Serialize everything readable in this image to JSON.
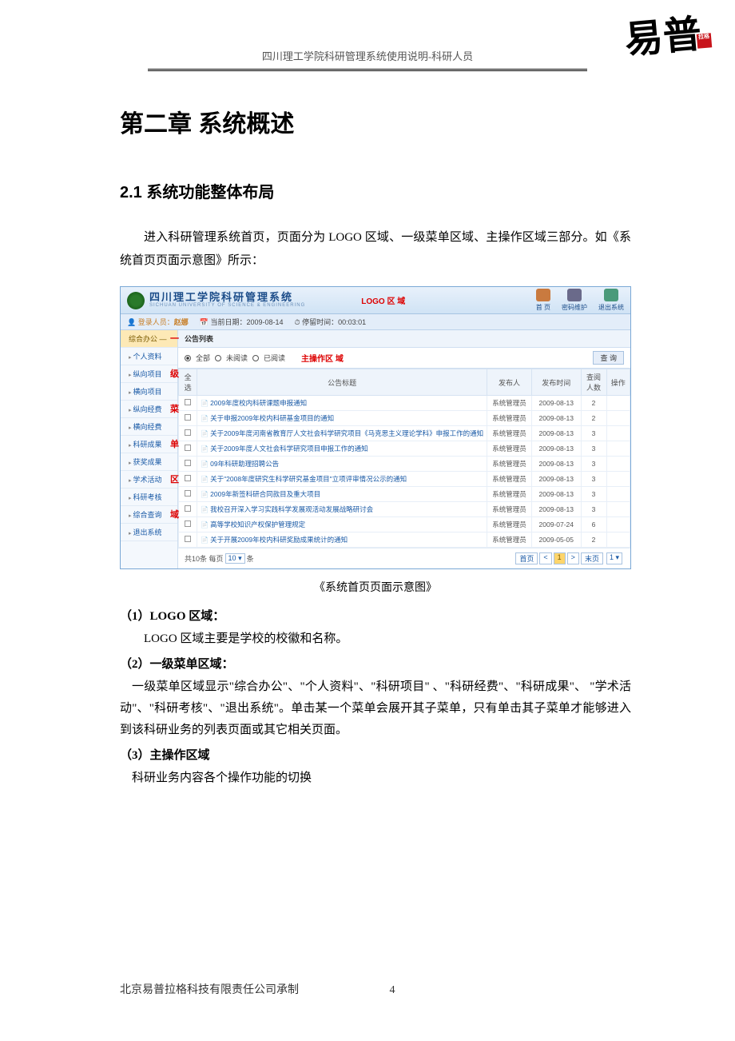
{
  "header": {
    "running_title": "四川理工学院科研管理系统使用说明-科研人员"
  },
  "seal_text": "易普",
  "chapter": "第二章  系统概述",
  "section": "2.1 系统功能整体布局",
  "intro_para": "进入科研管理系统首页，页面分为 LOGO 区域、一级菜单区域、主操作区域三部分。如《系统首页页面示意图》所示：",
  "figure_caption": "《系统首页页面示意图》",
  "sub1_title": "（1）LOGO 区域：",
  "sub1_body": "LOGO 区域主要是学校的校徽和名称。",
  "sub2_title": "（2）一级菜单区域：",
  "sub2_body": "一级菜单区域显示\"综合办公\"、\"个人资料\"、\"科研项目\" 、\"科研经费\"、\"科研成果\"、 \"学术活动\"、\"科研考核\"、\"退出系统\"。单击某一个菜单会展开其子菜单，只有单击其子菜单才能够进入到该科研业务的列表页面或其它相关页面。",
  "sub3_title": "（3）主操作区域",
  "sub3_body": "科研业务内容各个操作功能的切换",
  "footer": {
    "company": "北京易普拉格科技有限责任公司承制",
    "page_number": "4"
  },
  "screenshot": {
    "system_title_cn": "四川理工学院科研管理系统",
    "system_title_en": "SICHUAN UNIVERSITY OF SCIENCE & ENGINEERING",
    "zone_logo_label": "LOGO  区 域",
    "top_icons": {
      "home": "首 页",
      "password": "密码维护",
      "exit": "退出系统"
    },
    "userbar": {
      "login_label": "登录人员：",
      "login_user": "赵娜",
      "date_label": "当前日期：",
      "date_value": "2009-08-14",
      "stay_label": "停留时间：",
      "stay_value": "00:03:01"
    },
    "sidebar_overlay": "级 菜 单 区 域",
    "sidebar": [
      "综合办公 —",
      "个人资料",
      "纵向项目",
      "横向项目",
      "纵向经费",
      "横向经费",
      "科研成果",
      "获奖成果",
      "学术活动",
      "科研考核",
      "综合查询",
      "退出系统"
    ],
    "sidebar_highlights": [
      "一",
      "",
      "级",
      "",
      "菜",
      "",
      "单",
      "",
      "区",
      "",
      "域",
      ""
    ],
    "panel_title": "公告列表",
    "filter": {
      "all": "全部",
      "unread": "未阅读",
      "read": "已阅读",
      "zone_label": "主操作区 域",
      "query_btn": "查 询"
    },
    "table": {
      "headers": [
        "全选",
        "公告标题",
        "发布人",
        "发布时间",
        "查阅人数",
        "操作"
      ],
      "rows": [
        {
          "title": "2009年度校内科研课题申报通知",
          "pub": "系统管理员",
          "date": "2009-08-13",
          "cnt": "2"
        },
        {
          "title": "关于申报2009年校内科研基金项目的通知",
          "pub": "系统管理员",
          "date": "2009-08-13",
          "cnt": "2"
        },
        {
          "title": "关于2009年度河南省教育厅人文社会科学研究项目《马克思主义理论学科》申报工作的通知",
          "pub": "系统管理员",
          "date": "2009-08-13",
          "cnt": "3"
        },
        {
          "title": "关于2009年度人文社会科学研究项目申报工作的通知",
          "pub": "系统管理员",
          "date": "2009-08-13",
          "cnt": "3"
        },
        {
          "title": "09年科研助理招聘公告",
          "pub": "系统管理员",
          "date": "2009-08-13",
          "cnt": "3"
        },
        {
          "title": "关于\"2008年度研究生科学研究基金项目\"立项评审情况公示的通知",
          "pub": "系统管理员",
          "date": "2009-08-13",
          "cnt": "3"
        },
        {
          "title": "2009年新签科研合同款目及重大项目",
          "pub": "系统管理员",
          "date": "2009-08-13",
          "cnt": "3"
        },
        {
          "title": "我校召开深入学习实践科学发展观活动发展战略研讨会",
          "pub": "系统管理员",
          "date": "2009-08-13",
          "cnt": "3"
        },
        {
          "title": "高等学校知识产权保护管理规定",
          "pub": "系统管理员",
          "date": "2009-07-24",
          "cnt": "6"
        },
        {
          "title": "关于开展2009年校内科研奖励成果统计的通知",
          "pub": "系统管理员",
          "date": "2009-05-05",
          "cnt": "2"
        }
      ]
    },
    "pager": {
      "total_prefix": "共",
      "total_mid": "条 每页",
      "total_suffix": "条",
      "total_count": "10",
      "per_page": "10",
      "first": "首页",
      "prev": "<",
      "page": "1",
      "next": ">",
      "last": "末页",
      "jump": "1"
    }
  }
}
